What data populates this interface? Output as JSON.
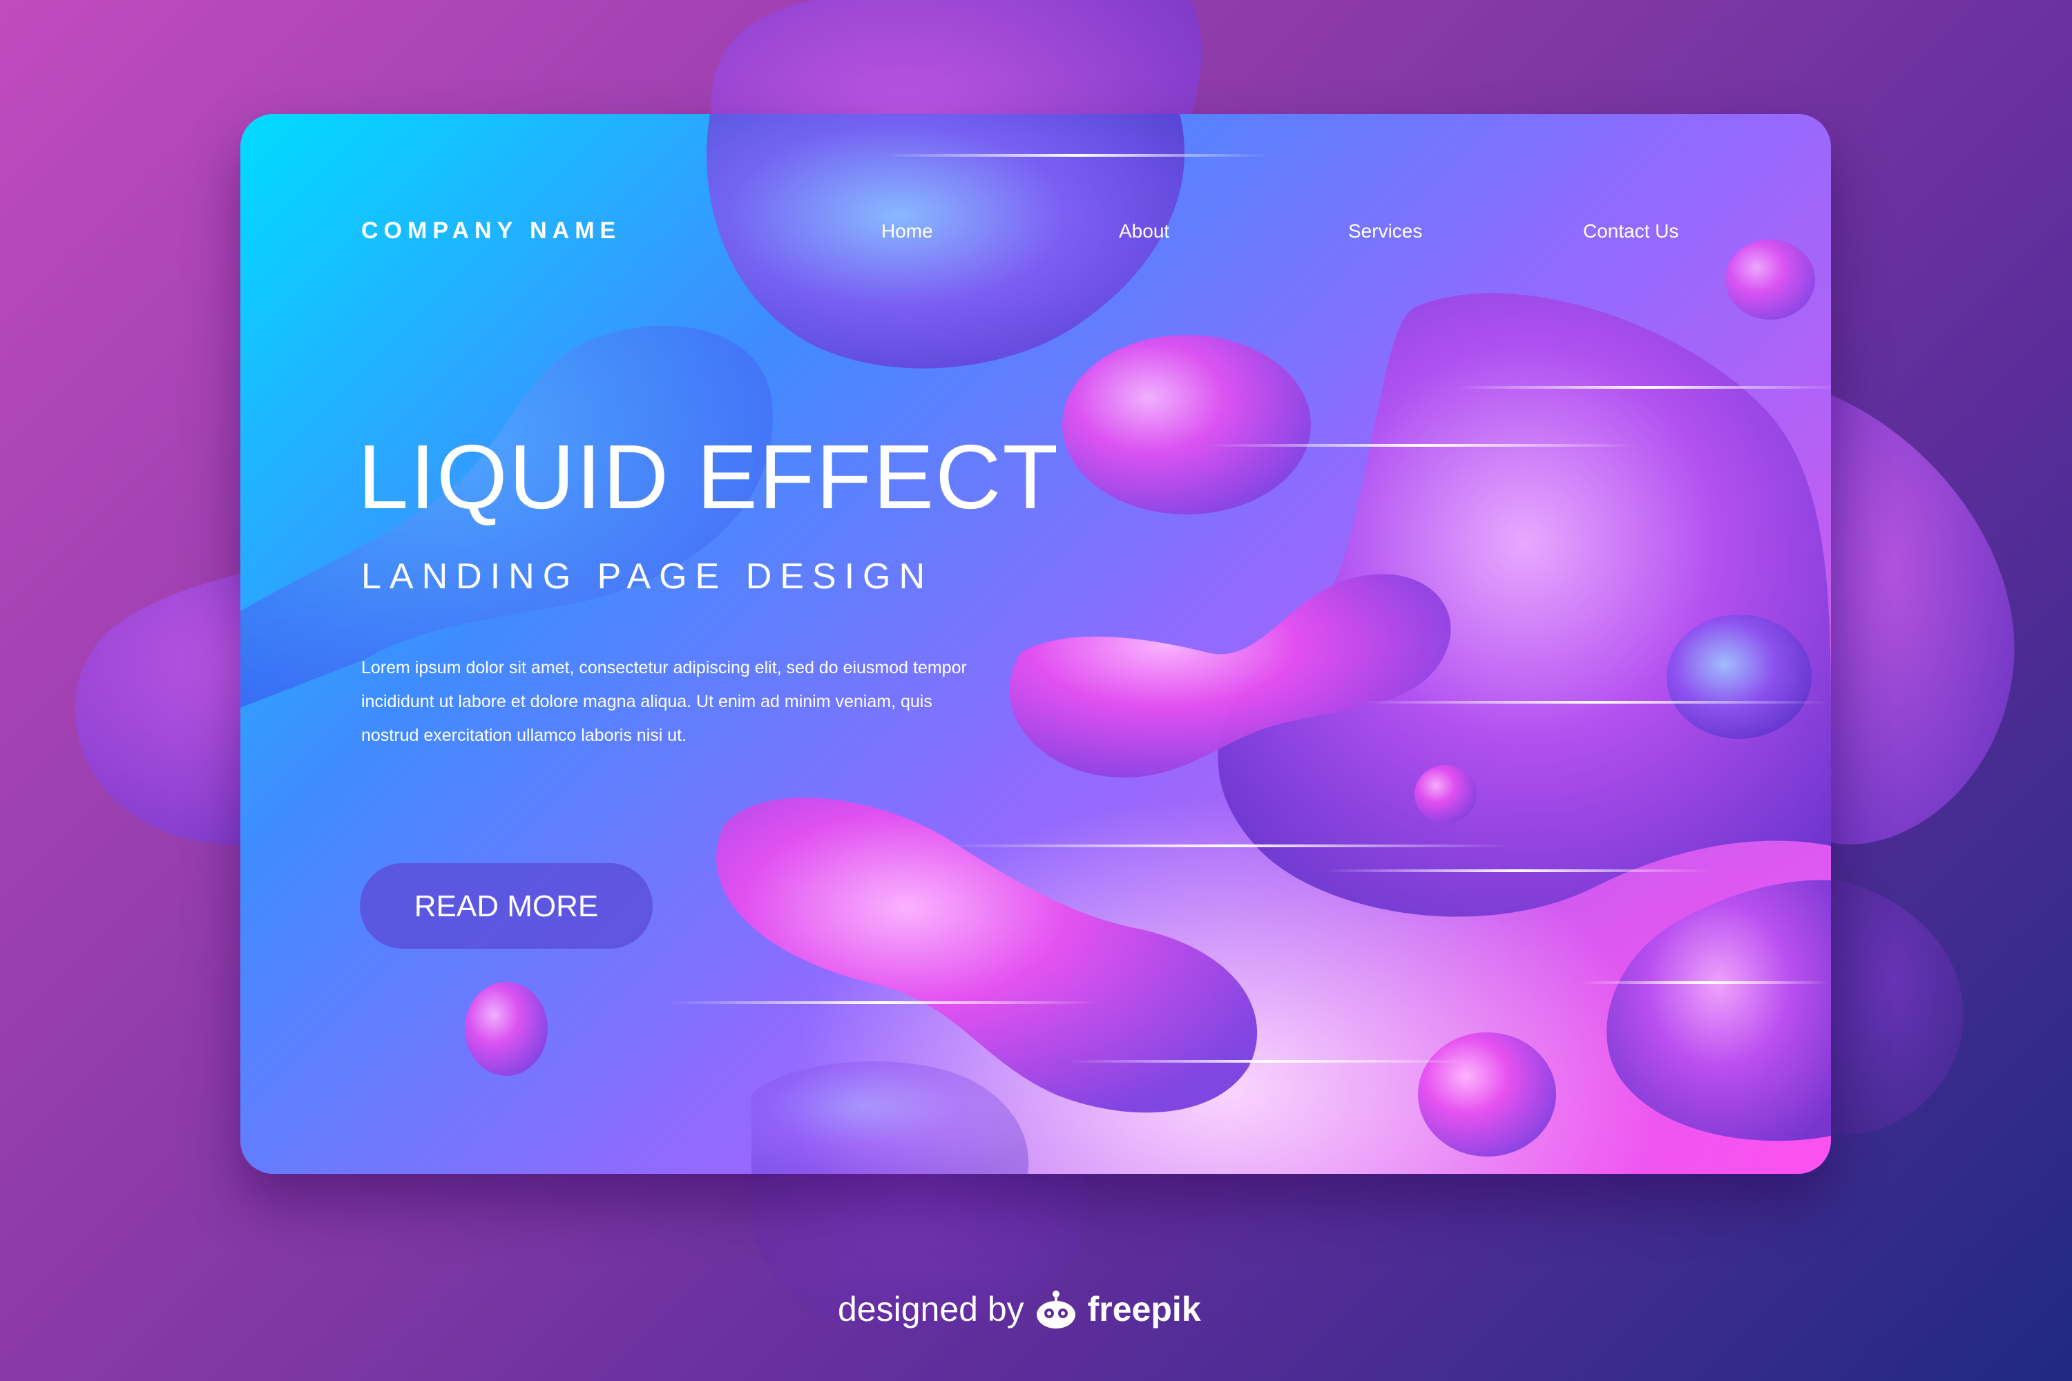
{
  "header": {
    "company_name": "COMPANY NAME",
    "nav": [
      {
        "label": "Home"
      },
      {
        "label": "About"
      },
      {
        "label": "Services"
      },
      {
        "label": "Contact Us"
      }
    ]
  },
  "hero": {
    "title": "LIQUID EFFECT",
    "subtitle": "LANDING PAGE DESIGN",
    "body": "Lorem ipsum dolor sit amet, consectetur adipiscing elit, sed do eiusmod tempor incididunt ut labore et dolore magna aliqua. Ut enim ad minim veniam, quis nostrud exercitation ullamco laboris nisi ut.",
    "cta_label": "READ MORE"
  },
  "footer": {
    "credit_prefix": "designed by",
    "credit_brand": "freepik",
    "brand_icon": "freepik-robot-icon"
  },
  "colors": {
    "background_start": "#c04bbf",
    "background_end": "#1f2a80",
    "card_start": "#00dcff",
    "card_end": "#e05cf5",
    "button": "#5c50dc",
    "text": "#ffffff"
  }
}
